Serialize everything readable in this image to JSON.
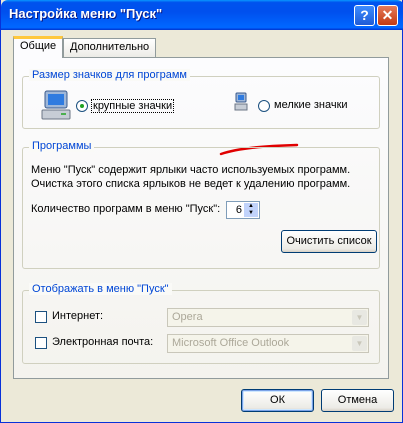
{
  "window": {
    "title": "Настройка меню \"Пуск\"",
    "help_glyph": "?",
    "close_glyph": "✕"
  },
  "tabs": [
    {
      "label": "Общие"
    },
    {
      "label": "Дополнительно"
    }
  ],
  "icon_size": {
    "group_label": "Размер значков для программ",
    "large_label": "крупные значки",
    "small_label": "мелкие значки",
    "selected": "large"
  },
  "programs": {
    "group_label": "Программы",
    "description": [
      "Меню \"Пуск\" содержит ярлыки часто используемых программ.",
      "Очистка этого списка ярлыков не ведет к удалению программ."
    ],
    "count_label": "Количество программ в меню \"Пуск\":",
    "count_value": "6",
    "clear_button": "Очистить список"
  },
  "show_in_menu": {
    "group_label": "Отображать в меню \"Пуск\"",
    "internet_label": "Интернет:",
    "internet_value": "Opera",
    "email_label": "Электронная почта:",
    "email_value": "Microsoft Office Outlook"
  },
  "buttons": {
    "ok": "ОК",
    "cancel": "Отмена"
  },
  "annotation_color": "#e00000"
}
